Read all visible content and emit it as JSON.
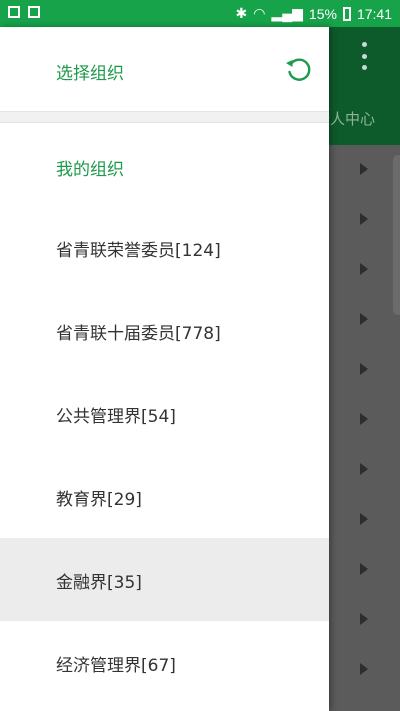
{
  "status_bar": {
    "battery": "15%",
    "time": "17:41"
  },
  "drawer": {
    "title": "选择组织",
    "refresh_icon": "refresh-icon",
    "section_label": "我的组织",
    "organizations": [
      {
        "label": "省青联荣誉委员[124]"
      },
      {
        "label": "省青联十届委员[778]"
      },
      {
        "label": "公共管理界[54]"
      },
      {
        "label": "教育界[29]"
      },
      {
        "label": "金融界[35]",
        "selected": true
      },
      {
        "label": "经济管理界[67]"
      }
    ]
  },
  "background_screen": {
    "tab_label": "个人中心",
    "overflow_icon": "more-vert-icon",
    "row_arrow_icon": "arrow-right-icon"
  },
  "colors": {
    "status_bar": "#16a34a",
    "accent": "#1d9a4b",
    "toolbar": "#0d5a2b",
    "selected_row": "#ececec"
  }
}
